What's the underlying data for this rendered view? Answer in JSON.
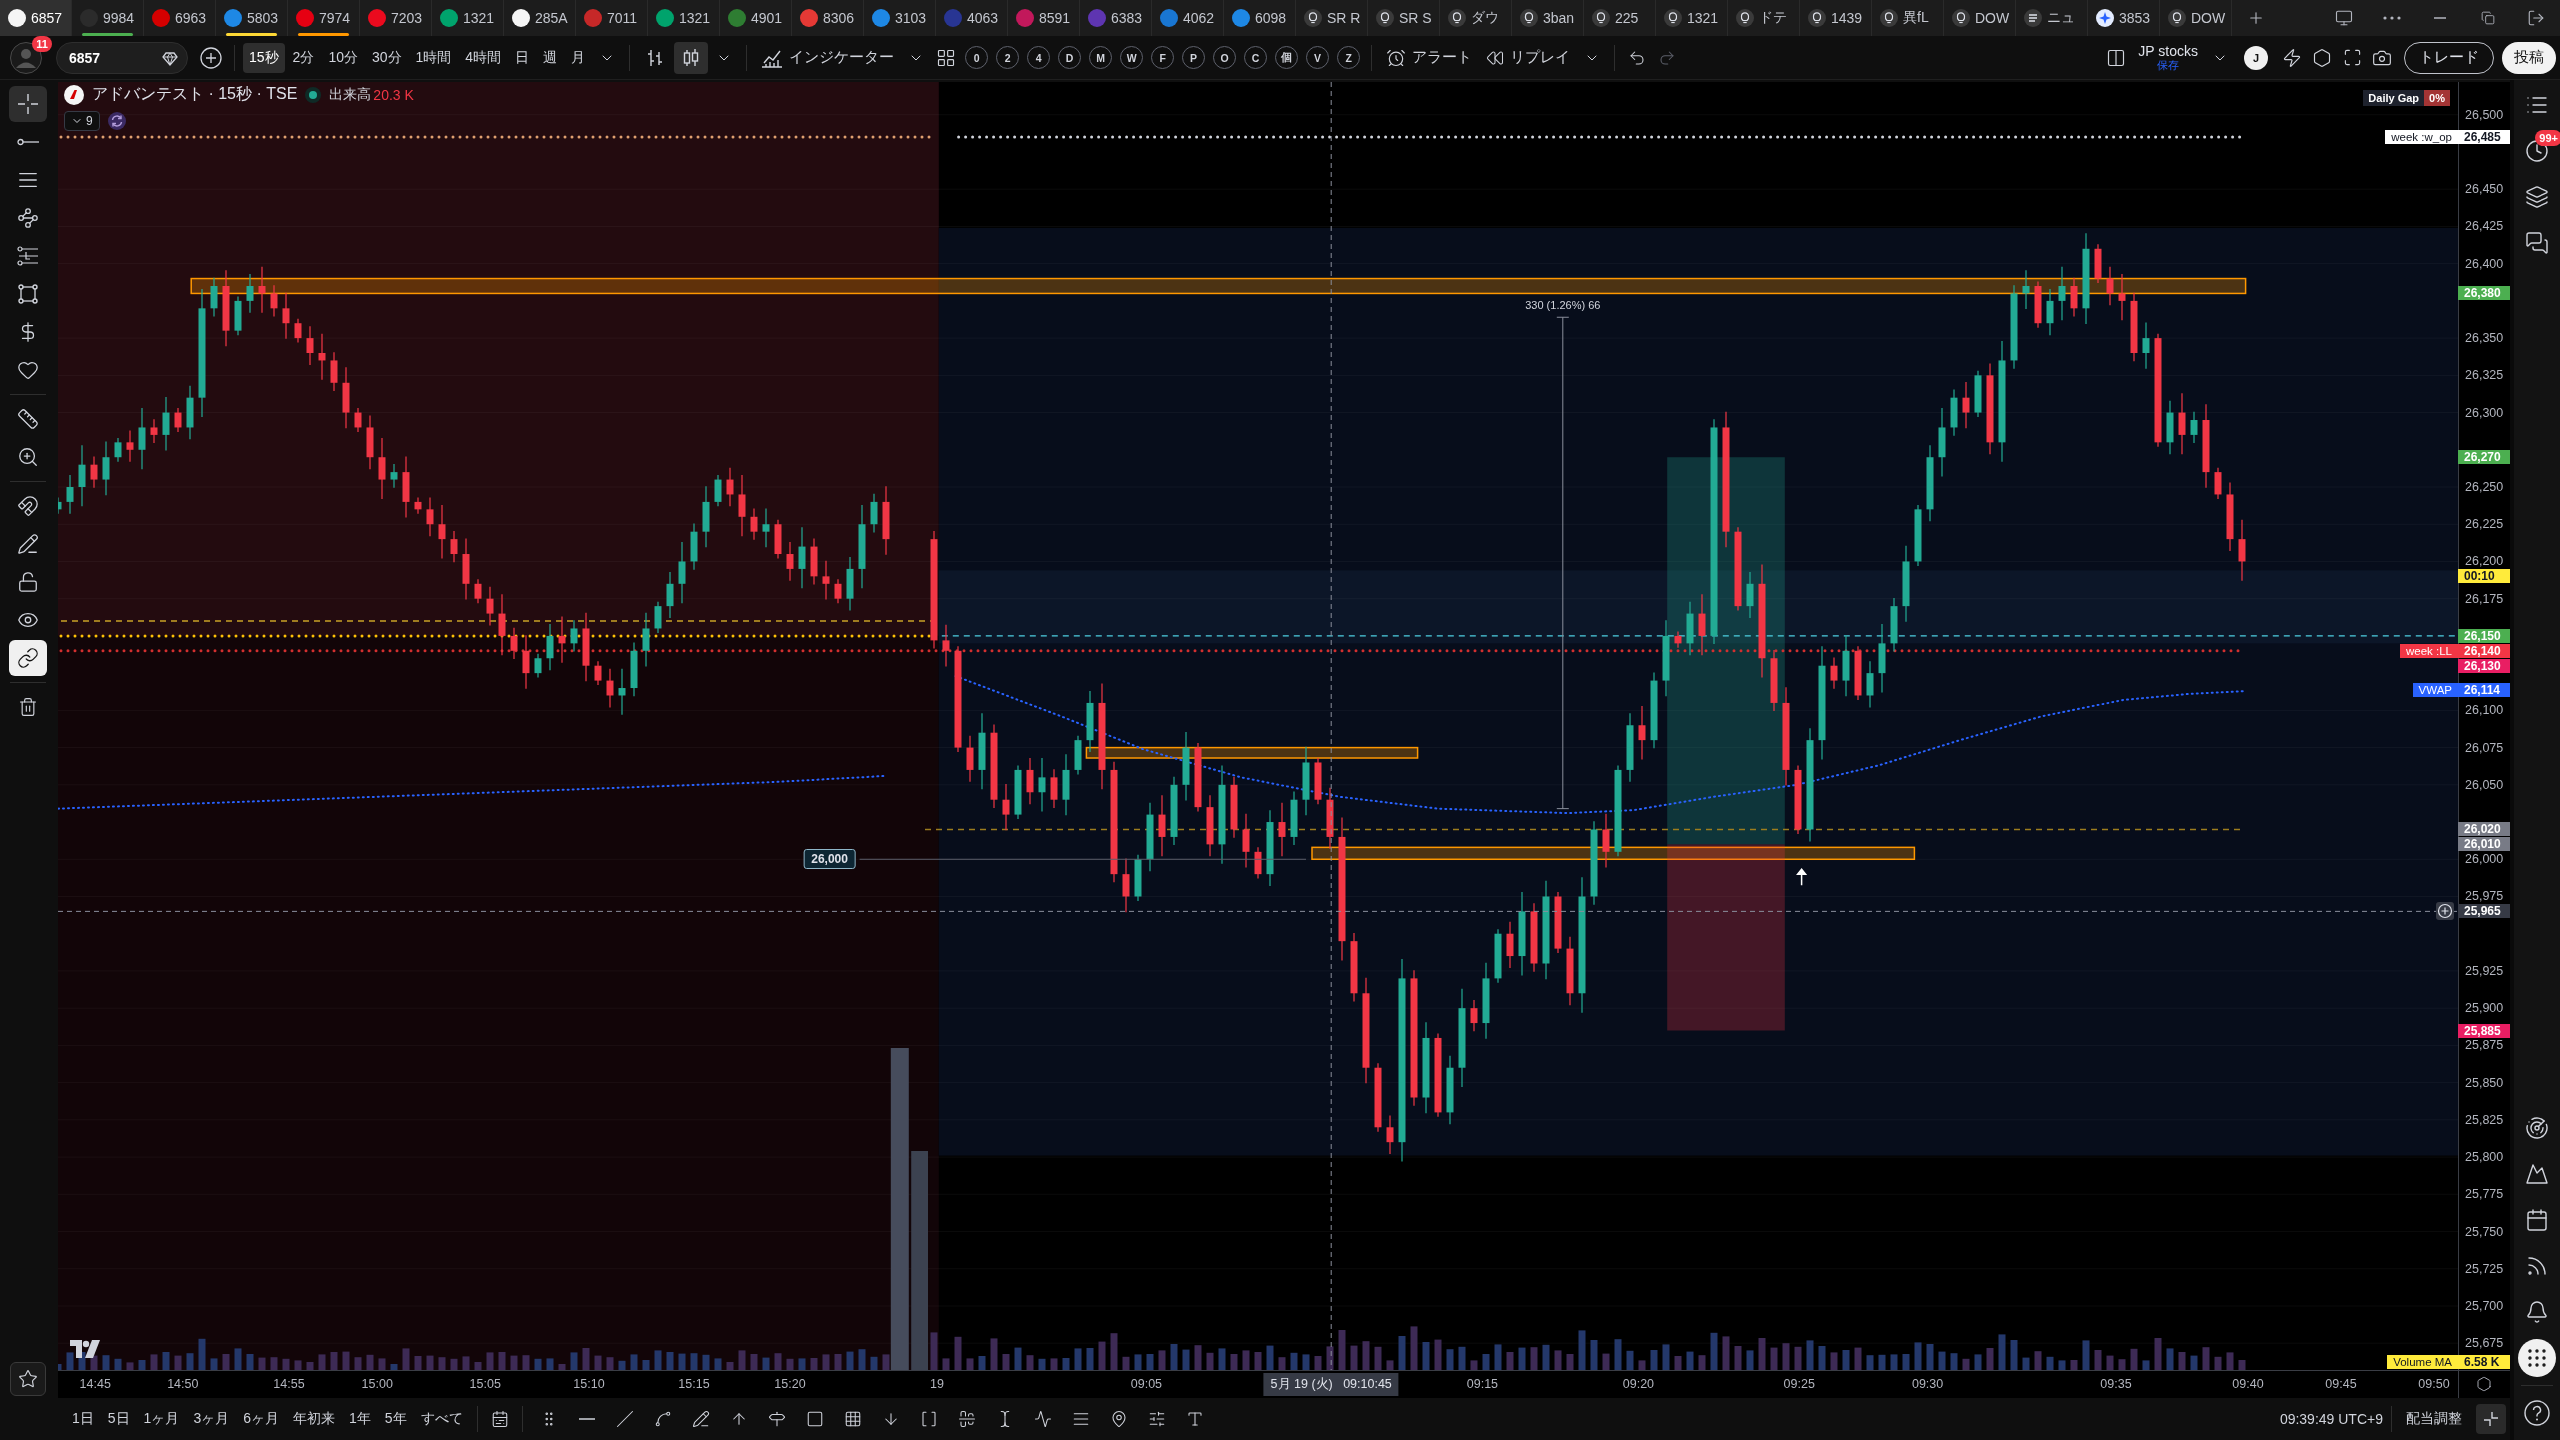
{
  "tabs": [
    {
      "label": "6857",
      "kind": "symbol",
      "selected": true
    },
    {
      "label": "9984",
      "kind": "symbol",
      "color": "#4caf50",
      "selected": false
    },
    {
      "label": "6963",
      "kind": "symbol",
      "selected": false
    },
    {
      "label": "5803",
      "kind": "symbol",
      "color": "#fdd835",
      "selected": false
    },
    {
      "label": "7974",
      "kind": "symbol",
      "color": "#ff9800",
      "selected": false
    },
    {
      "label": "7203",
      "kind": "symbol",
      "selected": false
    },
    {
      "label": "1321",
      "kind": "symbol",
      "selected": false
    },
    {
      "label": "285A",
      "kind": "symbol",
      "selected": false
    },
    {
      "label": "7011",
      "kind": "symbol",
      "selected": false
    },
    {
      "label": "1321",
      "kind": "symbol",
      "selected": false
    },
    {
      "label": "4901",
      "kind": "symbol",
      "selected": false
    },
    {
      "label": "8306",
      "kind": "symbol",
      "selected": false
    },
    {
      "label": "3103",
      "kind": "symbol",
      "selected": false
    },
    {
      "label": "4063",
      "kind": "symbol",
      "selected": false
    },
    {
      "label": "8591",
      "kind": "symbol",
      "selected": false
    },
    {
      "label": "6383",
      "kind": "symbol",
      "selected": false
    },
    {
      "label": "4062",
      "kind": "symbol",
      "selected": false
    },
    {
      "label": "6098",
      "kind": "symbol",
      "selected": false
    },
    {
      "label": "SR R",
      "kind": "idea",
      "selected": false
    },
    {
      "label": "SR S",
      "kind": "idea",
      "selected": false
    },
    {
      "label": "ダウ",
      "kind": "idea",
      "selected": false
    },
    {
      "label": "3ban",
      "kind": "idea",
      "selected": false
    },
    {
      "label": "225",
      "kind": "idea",
      "selected": false
    },
    {
      "label": "1321",
      "kind": "idea",
      "selected": false
    },
    {
      "label": "ドテ",
      "kind": "idea",
      "selected": false
    },
    {
      "label": "1439",
      "kind": "idea",
      "selected": false
    },
    {
      "label": "異fL",
      "kind": "idea",
      "selected": false
    },
    {
      "label": "DOW",
      "kind": "idea",
      "selected": false
    },
    {
      "label": "ニュ",
      "kind": "news",
      "selected": false
    },
    {
      "label": "3853",
      "kind": "spark",
      "selected": false
    },
    {
      "label": "DOW",
      "kind": "idea",
      "selected": false
    }
  ],
  "toolbar": {
    "notification_count": "11",
    "symbol": "6857",
    "intervals": [
      {
        "label": "15秒",
        "selected": true
      },
      {
        "label": "2分",
        "selected": false
      },
      {
        "label": "10分",
        "selected": false
      },
      {
        "label": "30分",
        "selected": false
      },
      {
        "label": "1時間",
        "selected": false
      },
      {
        "label": "4時間",
        "selected": false
      },
      {
        "label": "日",
        "selected": false
      },
      {
        "label": "週",
        "selected": false
      },
      {
        "label": "月",
        "selected": false
      }
    ],
    "chart_styles": [
      {
        "selected": false
      },
      {
        "selected": true
      }
    ],
    "indicators_label": "インジケーター",
    "hotkeys": [
      "0",
      "2",
      "4",
      "D",
      "M",
      "W",
      "F",
      "P",
      "O",
      "C",
      "個",
      "V",
      "Z"
    ],
    "alert_label": "アラート",
    "replay_label": "リプレイ",
    "layout_name": "JP stocks",
    "layout_status": "保存",
    "user_initial": "J",
    "trade_label": "トレード",
    "publish_label": "投稿"
  },
  "left_toolbar": {
    "tools": [
      {
        "selected": true
      },
      {
        "selected": false
      },
      {
        "selected": false
      },
      {
        "selected": false
      },
      {
        "selected": false
      },
      {
        "selected": false
      },
      {
        "selected": false
      },
      {
        "selected": false
      },
      {
        "selected": false
      },
      {
        "selected": false
      }
    ],
    "toggles": [
      {
        "on": false
      },
      {
        "on": false
      },
      {
        "on": false
      },
      {
        "on": false
      },
      {
        "on": true
      }
    ]
  },
  "chart": {
    "title": "アドバンテスト · 15秒 · TSE",
    "volume_label": "出来高",
    "volume_value": "20.3 K",
    "indicator_count": "9",
    "daily_gap_label": "Daily Gap",
    "daily_gap_value": "0%",
    "price_axis": [
      "26,500",
      "26,450",
      "26,425",
      "26,400",
      "26,350",
      "26,325",
      "26,300",
      "26,250",
      "26,225",
      "26,200",
      "26,175",
      "26,100",
      "26,075",
      "26,050",
      "26,000",
      "25,975",
      "25,925",
      "25,900",
      "25,875",
      "25,850",
      "25,825",
      "25,800",
      "25,775",
      "25,750",
      "25,725",
      "25,700",
      "25,675"
    ],
    "time_axis": [
      "14:45",
      "14:50",
      "14:55",
      "15:00",
      "15:05",
      "15:10",
      "15:15",
      "15:20",
      "19",
      "09:05",
      "09:15",
      "09:20",
      "09:25",
      "09:30",
      "09:35",
      "09:40",
      "09:45",
      "09:50"
    ],
    "price_tags": [
      {
        "label": "26,485",
        "color": "#ffffff",
        "note": "week :w_op"
      },
      {
        "label": "26,380",
        "color": "#4caf50"
      },
      {
        "label": "26,270",
        "color": "#4caf50"
      },
      {
        "label": "00:10",
        "color": "#ffeb3b"
      },
      {
        "label": "26,150",
        "color": "#4caf50"
      },
      {
        "label": "26,140",
        "color": "#f23645",
        "note": "week :LL"
      },
      {
        "label": "26,130",
        "color": "#e91e63"
      },
      {
        "label": "26,114",
        "color": "#2962ff",
        "note": "VWAP"
      },
      {
        "label": "26,020",
        "color": "#787b86"
      },
      {
        "label": "26,010",
        "color": "#787b86"
      },
      {
        "label": "25,885",
        "color": "#e91e63"
      }
    ],
    "measure_label": "330 (1.26%) 66",
    "level_label": "26,000",
    "crosshair_price": "25,965",
    "crosshair_time": "5月 19 (火)   09:10:45",
    "volume_ma_label": "Volume MA",
    "volume_ma_value": "6.58 K"
  },
  "right_sidebar": {
    "top": [
      {
        "selected": false
      },
      {
        "selected": false,
        "badge": "99+"
      },
      {
        "selected": false
      },
      {
        "selected": false
      }
    ],
    "bottom": [
      {
        "selected": false
      },
      {
        "selected": false
      },
      {
        "selected": false
      },
      {
        "selected": false
      },
      {
        "selected": false
      },
      {
        "selected": true
      },
      {
        "selected": false
      }
    ]
  },
  "bottom_bar": {
    "ranges": [
      "1日",
      "5日",
      "1ヶ月",
      "3ヶ月",
      "6ヶ月",
      "年初来",
      "1年",
      "5年",
      "すべて"
    ],
    "clock": "09:39:49 UTC+9",
    "adjustment_label": "配当調整"
  }
}
